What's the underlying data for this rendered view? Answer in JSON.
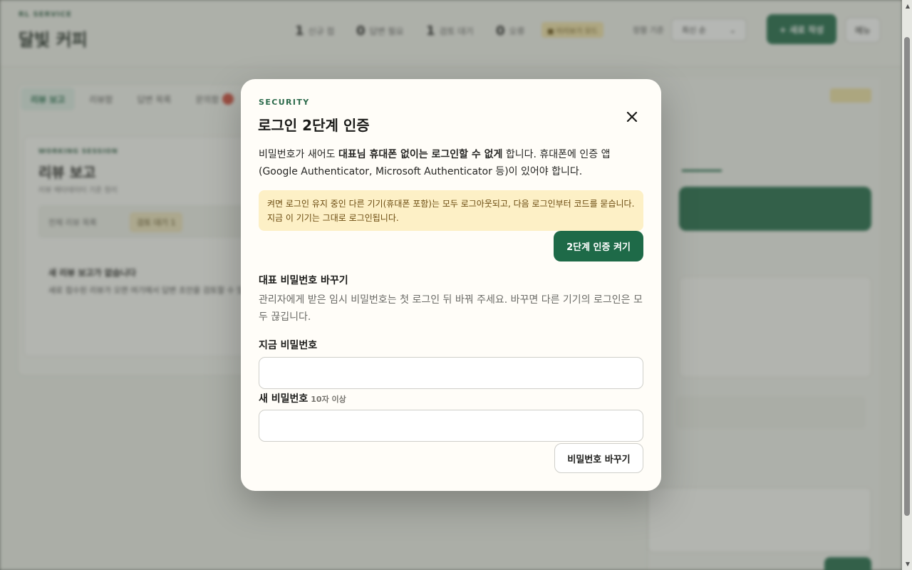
{
  "background": {
    "brand_kicker": "RL SERVICE",
    "brand_title": "달빛 커피",
    "stats": [
      {
        "count": "1",
        "label": "신규 접"
      },
      {
        "count": "0",
        "label": "답변 필요"
      },
      {
        "count": "1",
        "label": "검토 대기"
      },
      {
        "count": "0",
        "label": "오류"
      }
    ],
    "notice_pill": "■ 미리보기 모드",
    "sort_label": "정렬 기준",
    "sort_value": "최신 순",
    "cta_label": "+ 새로 작성",
    "menu_label": "메뉴",
    "tabs": [
      "리뷰 보고",
      "리뷰함",
      "답변 목록",
      "문의함"
    ],
    "inner_kicker": "WORKING SESSION",
    "inner_title": "리뷰 보고",
    "inner_sub": "리뷰 메타데이터 기준 정리",
    "filter_all": "전체 리뷰 목록",
    "filter_pending": "검토 대기 1",
    "empty_title": "새 리뷰 보고가 없습니다",
    "empty_text": "새로 접수된 리뷰가 오면 여기에서 답변 초안을 검토할 수 있어요."
  },
  "modal": {
    "kicker": "SECURITY",
    "title": "로그인 2단계 인증",
    "close_icon": "close-icon",
    "desc_pre": "비밀번호가 새어도 ",
    "desc_bold": "대표님 휴대폰 없이는 로그인할 수 없게",
    "desc_post": " 합니다. 휴대폰에 인증 앱 (Google Authenticator, Microsoft Authenticator 등)이 있어야 합니다.",
    "warning": "켜면 로그인 유지 중인 다른 기기(휴대폰 포함)는 모두 로그아웃되고, 다음 로그인부터 코드를 묻습니다. 지금 이 기기는 그대로 로그인됩니다.",
    "enable_button": "2단계 인증 켜기",
    "section_title": "대표 비밀번호 바꾸기",
    "section_desc": "관리자에게 받은 임시 비밀번호는 첫 로그인 뒤 바꿔 주세요. 바꾸면 다른 기기의 로그인은 모두 끊깁니다.",
    "current_label": "지금 비밀번호",
    "new_label": "새 비밀번호",
    "new_hint": "10자 이상",
    "current_value": "",
    "new_value": "",
    "change_button": "비밀번호 바꾸기"
  },
  "colors": {
    "accent": "#1e6a48",
    "warning_bg": "#fdf0c6",
    "warning_text": "#6a4a0f"
  }
}
